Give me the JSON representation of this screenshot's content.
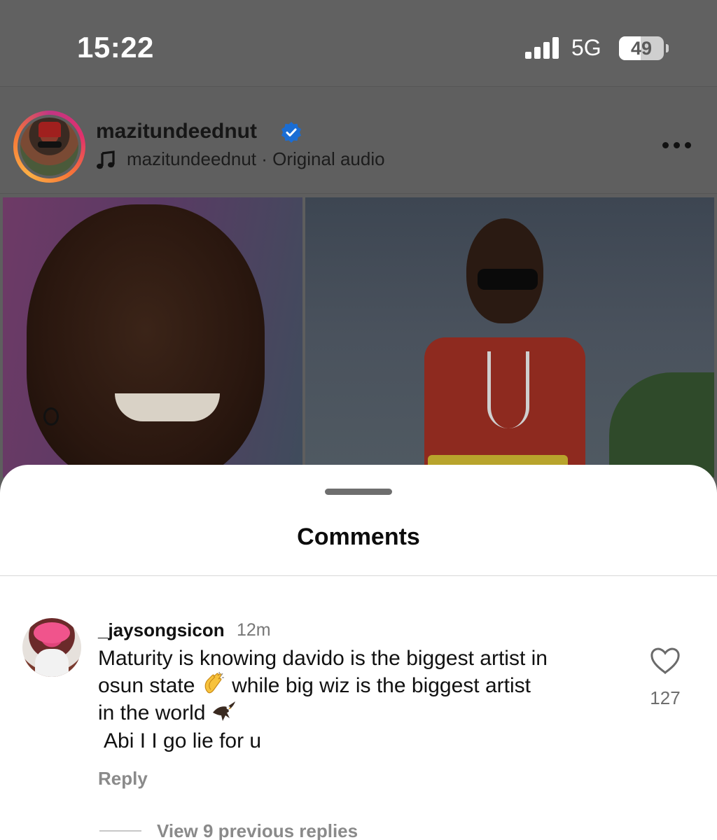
{
  "status_bar": {
    "time": "15:22",
    "network": "5G",
    "battery_level": "49",
    "battery_fraction": 0.49
  },
  "post": {
    "username": "mazitundeednut",
    "verified": true,
    "audio_label": "mazitundeednut · Original audio"
  },
  "comments_sheet": {
    "title": "Comments",
    "comment": {
      "username": "_jaysongsicon",
      "time": "12m",
      "text_line1": "Maturity is knowing davido is the  biggest artist in",
      "text_line2_a": "osun state",
      "text_line2_b": " while big wiz is the biggest artist",
      "text_line3": "in the world",
      "text_line4": "Abi I I go lie for u",
      "reply_label": "Reply",
      "like_count": "127"
    },
    "view_replies_label": "View 9 previous replies"
  },
  "icons": {
    "signal": "signal-bars-icon",
    "verified": "verified-badge-icon",
    "audio": "music-note-icon",
    "more": "more-dots-icon",
    "like": "heart-outline-icon",
    "emoji_clap": "clapping-hands-emoji",
    "emoji_eagle": "eagle-emoji"
  },
  "colors": {
    "verified_blue": "#1a6dd4",
    "story_ring": "#e1306c"
  }
}
